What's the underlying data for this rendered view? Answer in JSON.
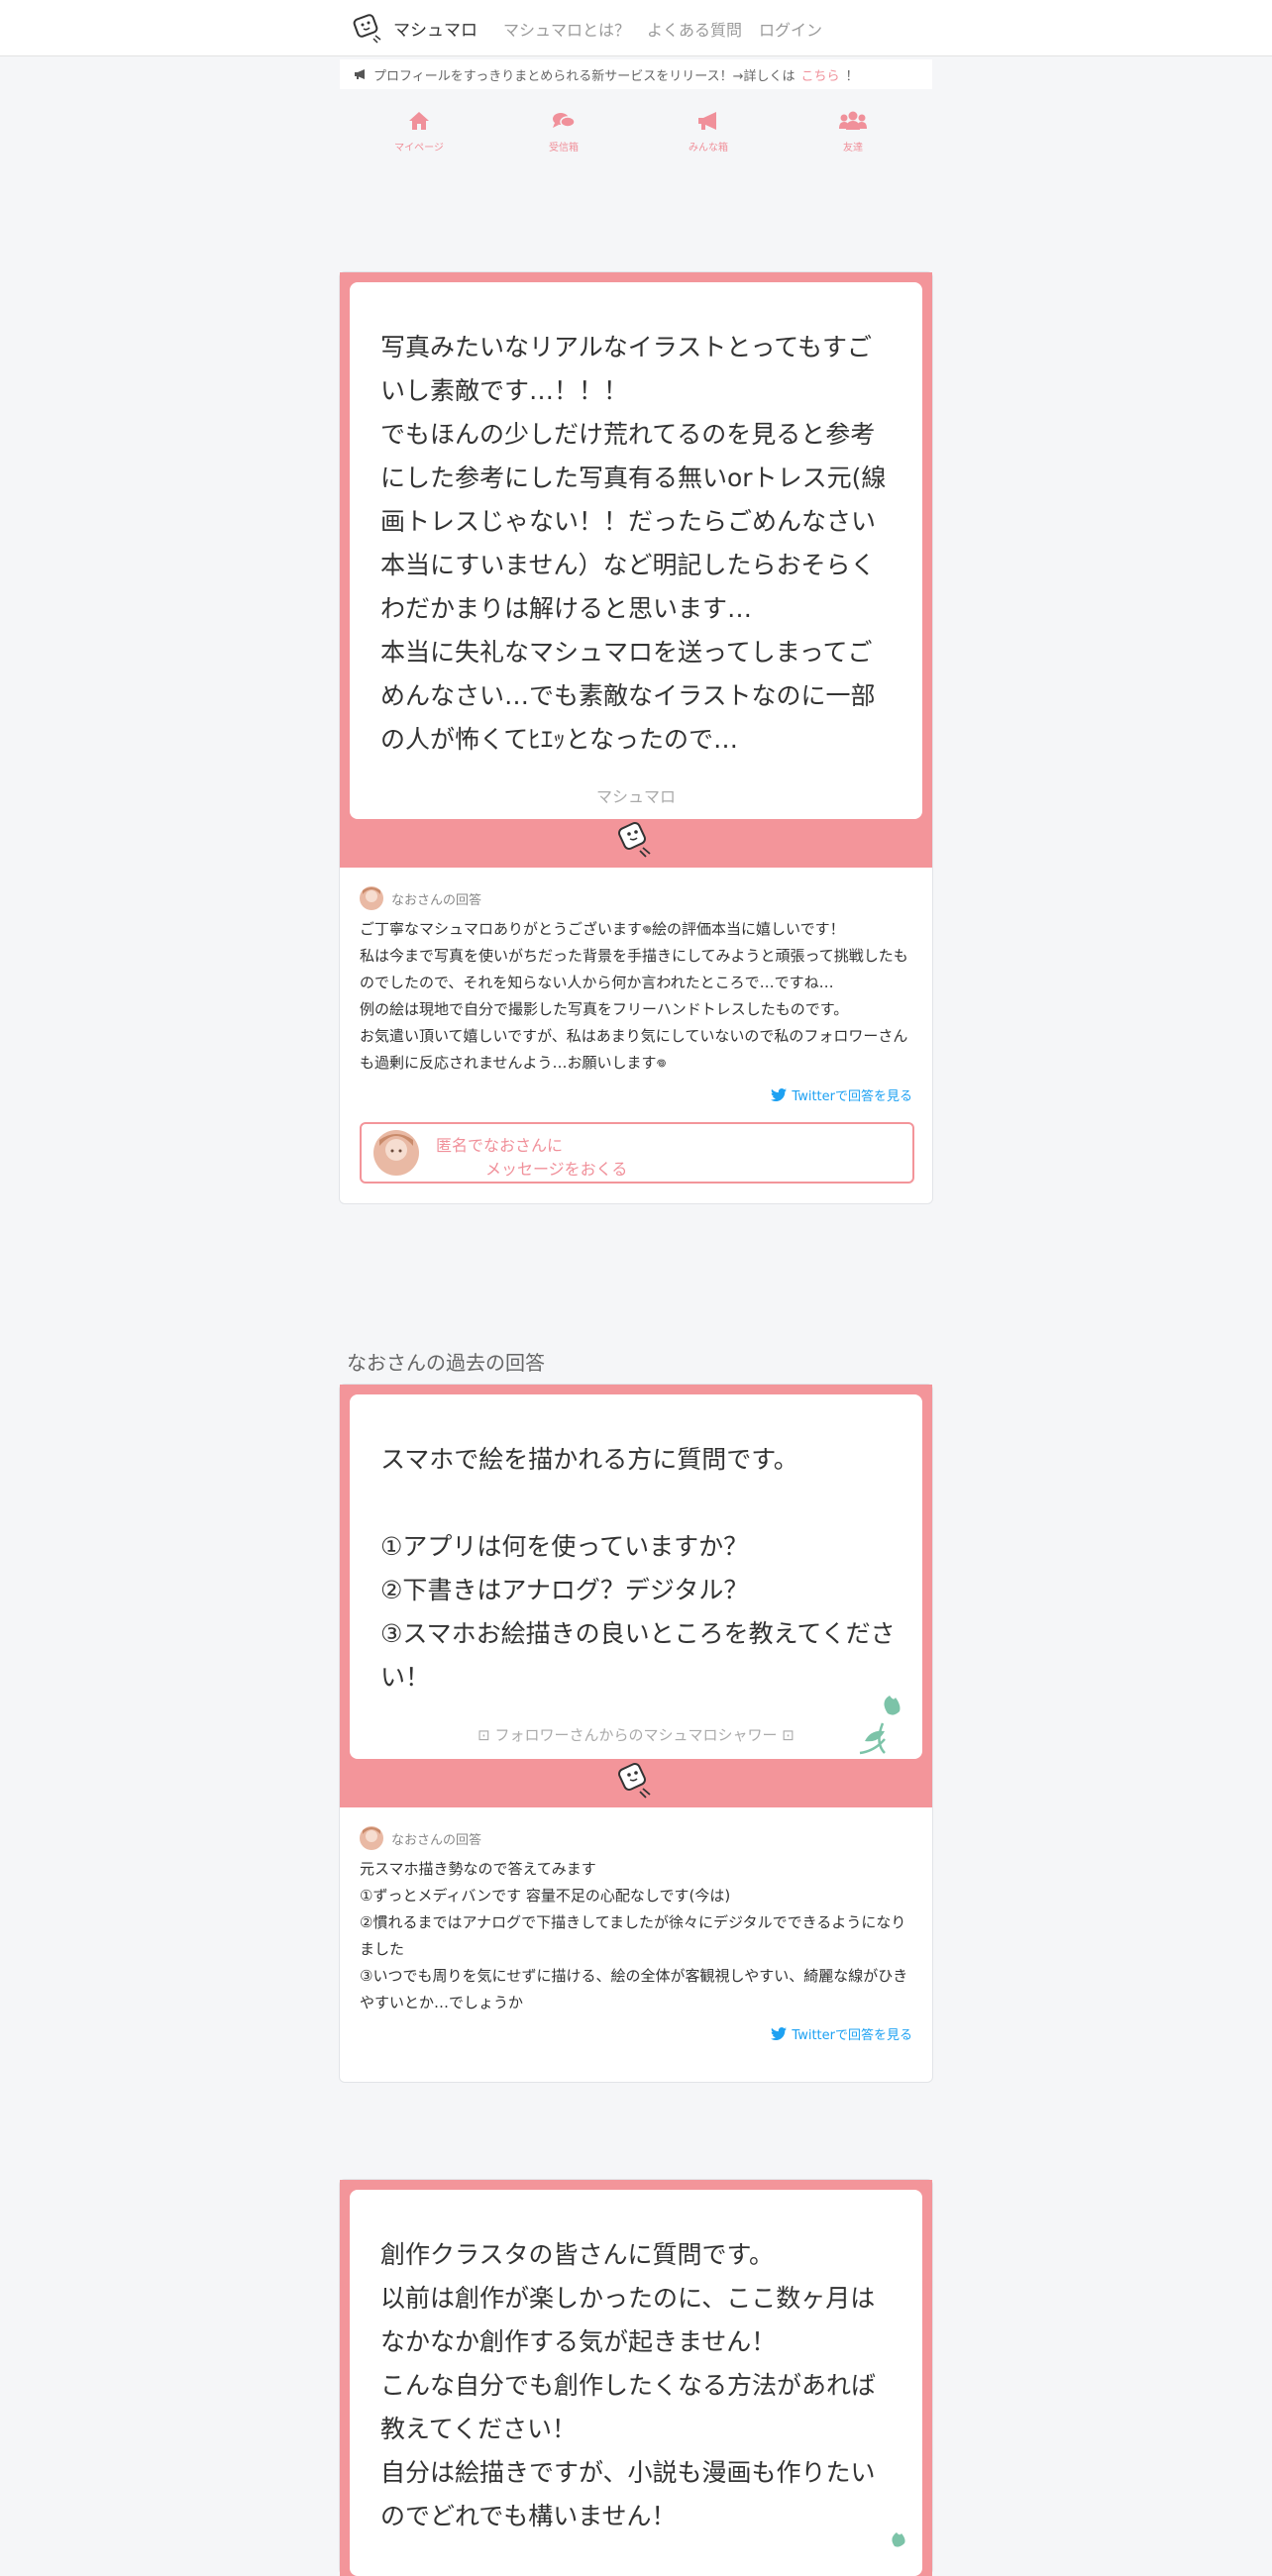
{
  "navbar": {
    "brand": "マシュマロ",
    "links": [
      "マシュマロとは？",
      "よくある質問",
      "ログイン"
    ]
  },
  "notice": {
    "text": "プロフィールをすっきりまとめられる新サービスをリリース！→詳しくは",
    "link": "こちら",
    "suffix": "！",
    "icon": "megaphone-icon"
  },
  "menu": [
    {
      "label": "マイページ",
      "icon": "home-icon"
    },
    {
      "label": "受信箱",
      "icon": "comments-icon"
    },
    {
      "label": "みんな箱",
      "icon": "bullhorn-icon"
    },
    {
      "label": "友達",
      "icon": "users-icon"
    }
  ],
  "cards": [
    {
      "question": "写真みたいなリアルなイラストとってもすごいし素敵です…！！！\nでもほんの少しだけ荒れてるのを見ると参考にした参考にした写真有る無いorトレス元(線画トレスじゃない！！だったらごめんなさい本当にすいません）など明記したらおそらくわだかまりは解けると思います…\n本当に失礼なマシュマロを送ってしまってごめんなさい…でも素敵なイラストなのに一部の人が怖くてﾋｴｯとなったので…",
      "footer": "マシュマロ",
      "answer_head": "なおさんの回答",
      "answer": "ご丁寧なマシュマロありがとうございます𖦹絵の評価本当に嬉しいです！\n私は今まで写真を使いがちだった背景を手描きにしてみようと頑張って挑戦したものでしたので、それを知らない人から何か言われたところで…ですね…\n例の絵は現地で自分で撮影した写真をフリーハンドトレスしたものです。\nお気遣い頂いて嬉しいですが、私はあまり気にしていないので私のフォロワーさんも過剰に反応されませんよう…お願いします𖦹",
      "twitter": "Twitterで回答を見る",
      "send_line1": "匿名でなおさんに",
      "send_line2": "メッセージをおくる"
    },
    {
      "question": "スマホで絵を描かれる方に質問です。\n\n①アプリは何を使っていますか？\n②下書きはアナログ？デジタル？\n③スマホお絵描きの良いところを教えてください！",
      "footer": "フォロワーさんからのマシュマロシャワー",
      "answer_head": "なおさんの回答",
      "answer": "元スマホ描き勢なので答えてみます\n①ずっとメディバンです 容量不足の心配なしです(今は)\n②慣れるまではアナログで下描きしてましたが徐々にデジタルでできるようになりました\n③いつでも周りを気にせずに描ける、絵の全体が客観視しやすい、綺麗な線がひきやすいとか…でしょうか",
      "twitter": "Twitterで回答を見る"
    },
    {
      "question": "創作クラスタの皆さんに質問です。\n以前は創作が楽しかったのに、ここ数ヶ月はなかなか創作する気が起きません！\nこんな自分でも創作したくなる方法があれば教えてください！\n自分は絵描きですが、小説も漫画も作りたいのでどれでも構いません！"
    }
  ],
  "past_title": "なおさんの過去の回答",
  "colors": {
    "accent": "#f3959a",
    "twitter": "#1da1f2",
    "background": "#f5f6f8"
  }
}
